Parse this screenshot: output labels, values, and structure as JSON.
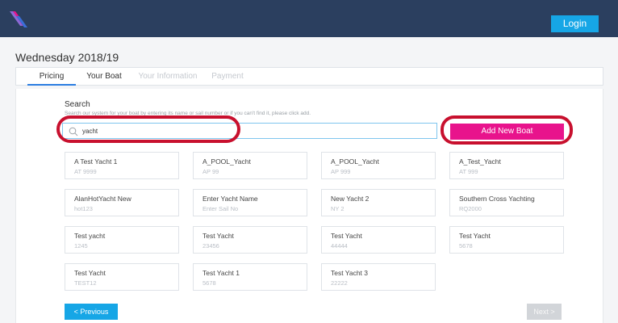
{
  "header": {
    "login_label": "Login"
  },
  "page": {
    "title": "Wednesday 2018/19"
  },
  "tabs": [
    {
      "label": "Pricing",
      "state": "active"
    },
    {
      "label": "Your Boat",
      "state": "normal"
    },
    {
      "label": "Your Information",
      "state": "disabled"
    },
    {
      "label": "Payment",
      "state": "disabled"
    }
  ],
  "search": {
    "label": "Search",
    "help_text": "Search our system for your boat by entering its name or sail number or if you can't find it, please click add.",
    "value": "yacht"
  },
  "add_button_label": "Add New Boat",
  "results": [
    {
      "name": "A Test Yacht 1",
      "sail": "AT 9999"
    },
    {
      "name": "A_POOL_Yacht",
      "sail": "AP 99"
    },
    {
      "name": "A_POOL_Yacht",
      "sail": "AP 999"
    },
    {
      "name": "A_Test_Yacht",
      "sail": "AT 999"
    },
    {
      "name": "AlanHotYacht New",
      "sail": "hot123"
    },
    {
      "name": "Enter Yacht Name",
      "sail": "Enter Sail No"
    },
    {
      "name": "New Yacht 2",
      "sail": "NY 2"
    },
    {
      "name": "Southern Cross Yachting",
      "sail": "RQ2000"
    },
    {
      "name": "Test yacht",
      "sail": "1245"
    },
    {
      "name": "Test Yacht",
      "sail": "23456"
    },
    {
      "name": "Test Yacht",
      "sail": "44444"
    },
    {
      "name": "Test Yacht",
      "sail": "5678"
    },
    {
      "name": "Test Yacht",
      "sail": "TEST12"
    },
    {
      "name": "Test Yacht 1",
      "sail": "5678"
    },
    {
      "name": "Test Yacht 3",
      "sail": "22222"
    }
  ],
  "nav": {
    "previous_label": "< Previous",
    "next_label": "Next >"
  },
  "colors": {
    "topbar": "#2b3f5f",
    "primary": "#16a6e6",
    "accent": "#e8138c",
    "annotation": "#c8102e"
  }
}
